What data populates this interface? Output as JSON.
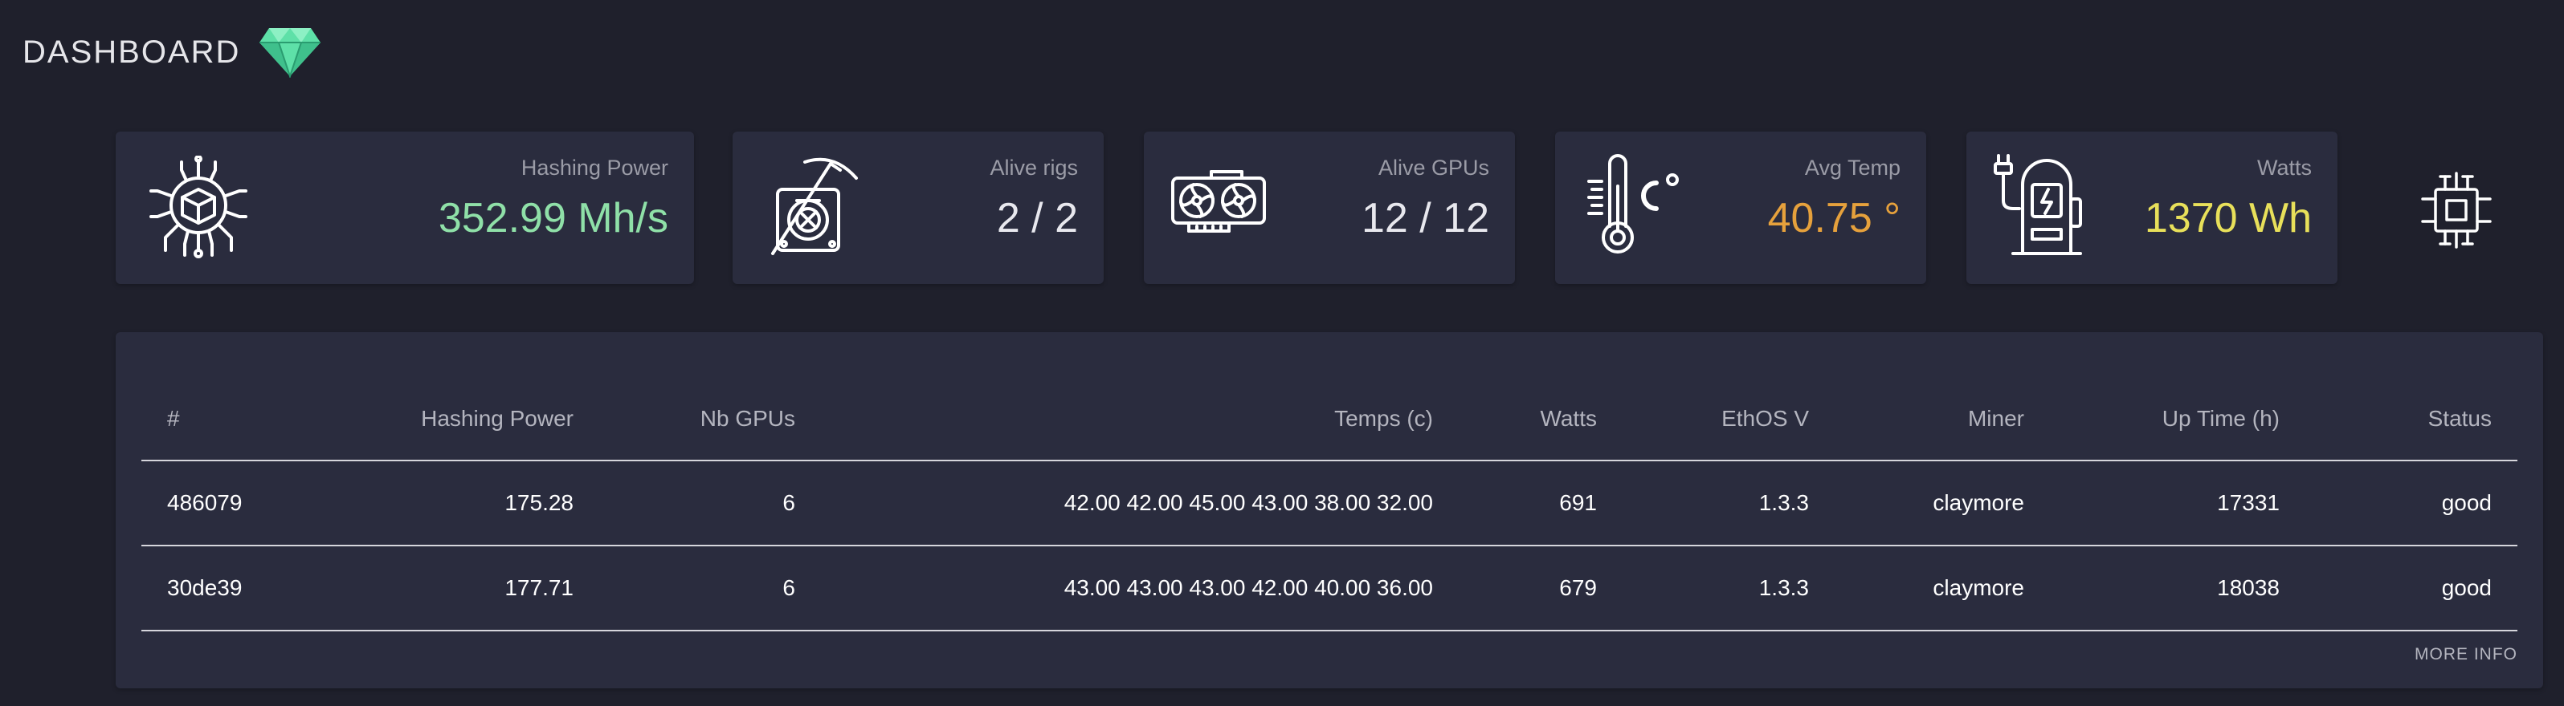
{
  "header": {
    "title": "DASHBOARD",
    "logo_icon": "diamond-icon",
    "logo_color": "#5ee0a8"
  },
  "cards": [
    {
      "key": "hashing",
      "label": "Hashing Power",
      "value": "352.99 Mh/s",
      "icon": "cpu-cube-icon",
      "value_color": "#8fe0a8"
    },
    {
      "key": "rigs",
      "label": "Alive rigs",
      "value": "2 / 2",
      "icon": "mining-rig-pickaxe-icon",
      "value_color": "#e8e8ee"
    },
    {
      "key": "gpus",
      "label": "Alive GPUs",
      "value": "12 / 12",
      "icon": "graphics-card-icon",
      "value_color": "#e8e8ee"
    },
    {
      "key": "temp",
      "label": "Avg Temp",
      "value": "40.75 °",
      "icon": "thermometer-celsius-icon",
      "value_color": "#e6a13c"
    },
    {
      "key": "watts",
      "label": "Watts",
      "value": "1370 Wh",
      "icon": "power-station-icon",
      "value_color": "#e8e05a"
    }
  ],
  "side_icon": "microchip-icon",
  "table": {
    "headers": [
      "#",
      "Hashing Power",
      "Nb GPUs",
      "Temps (c)",
      "Watts",
      "EthOS V",
      "Miner",
      "Up Time (h)",
      "Status"
    ],
    "rows": [
      [
        "486079",
        "175.28",
        "6",
        "42.00 42.00 45.00 43.00 38.00 32.00",
        "691",
        "1.3.3",
        "claymore",
        "17331",
        "good"
      ],
      [
        "30de39",
        "177.71",
        "6",
        "43.00 43.00 43.00 42.00 40.00 36.00",
        "679",
        "1.3.3",
        "claymore",
        "18038",
        "good"
      ]
    ],
    "more_info": "MORE INFO"
  }
}
